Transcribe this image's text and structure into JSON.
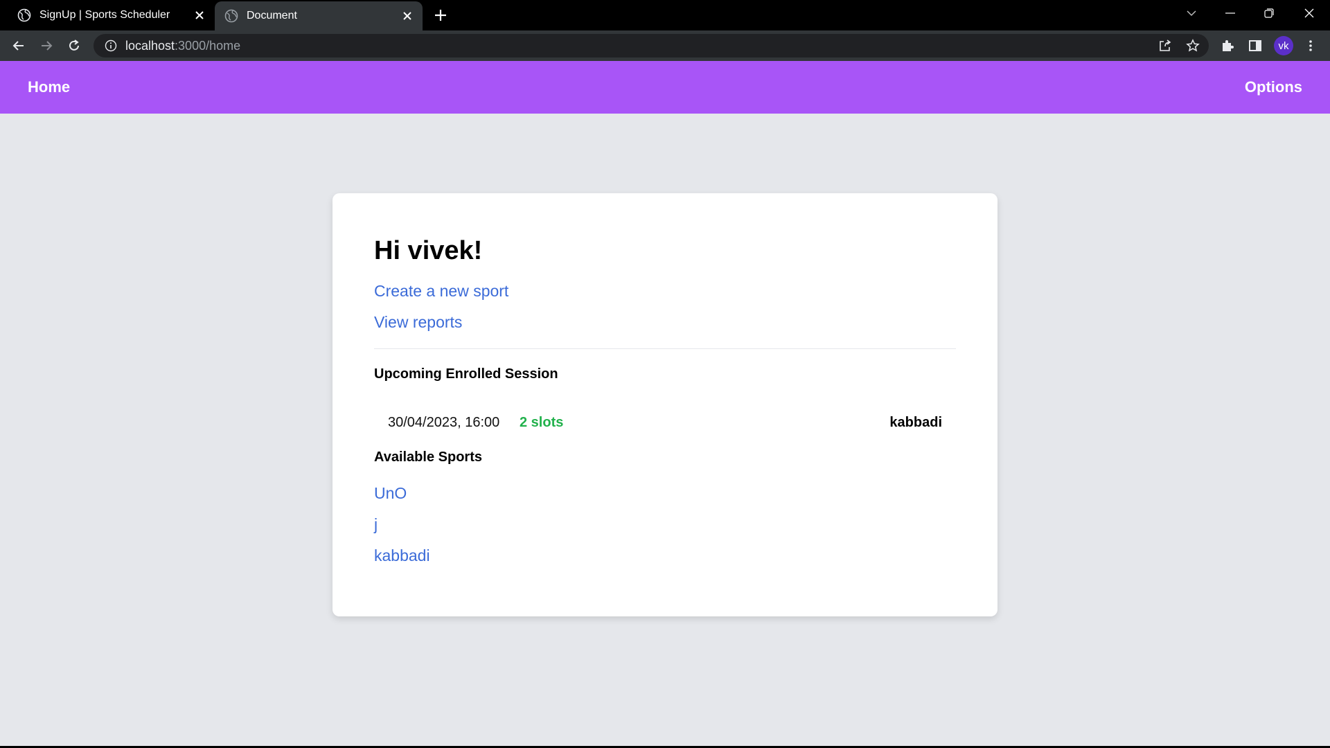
{
  "browser": {
    "tabs": [
      {
        "title": "SignUp | Sports Scheduler",
        "active": false
      },
      {
        "title": "Document",
        "active": true
      }
    ],
    "url_host": "localhost",
    "url_path": ":3000/home",
    "profile_initials": "vk"
  },
  "navbar": {
    "home_label": "Home",
    "options_label": "Options",
    "color": "#a855f7"
  },
  "main": {
    "greeting": "Hi vivek!",
    "create_link": "Create a new sport",
    "reports_link": "View reports",
    "upcoming_title": "Upcoming Enrolled Session",
    "sessions": [
      {
        "datetime": "30/04/2023, 16:00",
        "slots": "2 slots",
        "sport": "kabbadi"
      }
    ],
    "available_title": "Available Sports",
    "sports": [
      "UnO",
      "j",
      "kabbadi"
    ]
  },
  "colors": {
    "link": "#3b6bd8",
    "slots": "#22b14c",
    "background": "#e5e7eb"
  }
}
